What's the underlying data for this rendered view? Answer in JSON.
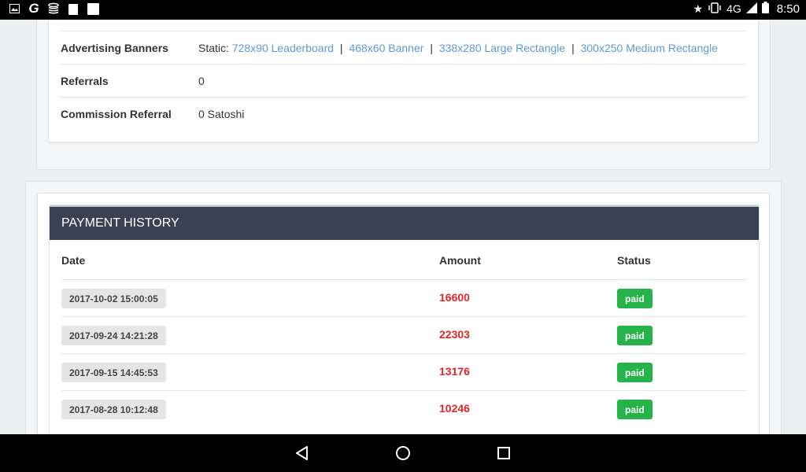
{
  "statusbar": {
    "left_icons": [
      "image-icon",
      "g-logo-icon",
      "coins-icon",
      "clipboard-icon",
      "square-icon"
    ],
    "network": "4G",
    "time": "8:50"
  },
  "referral_info": {
    "rows": [
      {
        "label": "Advertising Banners",
        "prefix": "Static: ",
        "links": [
          "728x90 Leaderboard",
          "468x60 Banner",
          "338x280 Large Rectangle",
          "300x250 Medium Rectangle"
        ],
        "separator": "|"
      },
      {
        "label": "Referrals",
        "value": "0"
      },
      {
        "label": "Commission Referral",
        "value": "0 Satoshi"
      }
    ]
  },
  "payment_history": {
    "title": "PAYMENT HISTORY",
    "columns": [
      "Date",
      "Amount",
      "Status"
    ],
    "rows": [
      {
        "date": "2017-10-02 15:00:05",
        "amount": "16600",
        "status": "paid"
      },
      {
        "date": "2017-09-24 14:21:28",
        "amount": "22303",
        "status": "paid"
      },
      {
        "date": "2017-09-15 14:45:53",
        "amount": "13176",
        "status": "paid"
      },
      {
        "date": "2017-08-28 10:12:48",
        "amount": "10246",
        "status": "paid"
      }
    ]
  },
  "colors": {
    "header_bg": "#3a4152",
    "link": "#5b9bd5",
    "amount": "#e3242b",
    "paid_badge": "#26b34a"
  }
}
